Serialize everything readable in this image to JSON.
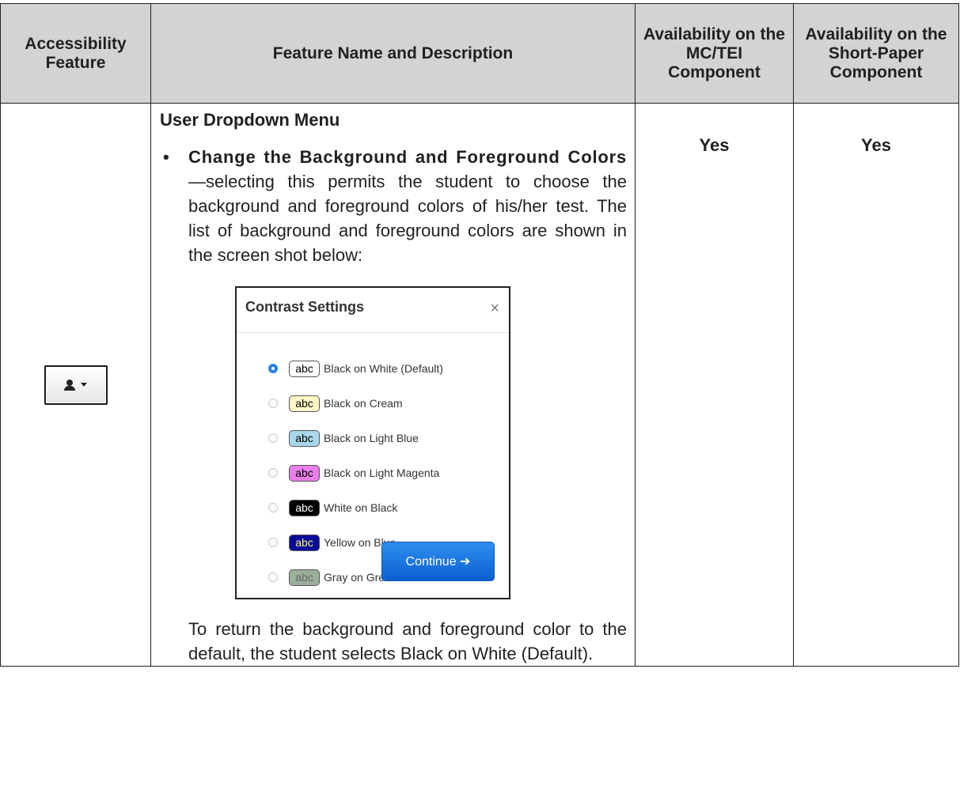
{
  "header": {
    "columns": [
      "Accessibility Feature",
      "Feature Name and Description",
      "Availability on the MC/TEI Component",
      "Availability on the Short-Paper Component"
    ]
  },
  "row": {
    "icon": "user-dropdown-icon",
    "menu_title": "User Dropdown Menu",
    "bullet": "•",
    "bullet_lead": "Change the Background and Foreground Colors",
    "bullet_body": "—selecting this permits the student to choose the background and foreground colors of his/her test. The list of background and foreground colors are shown in the screen shot below:",
    "after_text": "To return the background and foreground color to the default, the student selects Black on White (Default).",
    "mc_tei": "Yes",
    "short_paper": "Yes"
  },
  "dialog": {
    "title": "Contrast Settings",
    "close": "×",
    "continue_label": "Continue ➔",
    "options": [
      {
        "swatch": "abc",
        "label": "Black on White (Default)",
        "selected": true,
        "bg": "#ffffff",
        "fg": "#000000"
      },
      {
        "swatch": "abc",
        "label": "Black on Cream",
        "selected": false,
        "bg": "#fff6c4",
        "fg": "#000000"
      },
      {
        "swatch": "abc",
        "label": "Black on Light Blue",
        "selected": false,
        "bg": "#a9d8ec",
        "fg": "#000000"
      },
      {
        "swatch": "abc",
        "label": "Black on Light Magenta",
        "selected": false,
        "bg": "#e97fe9",
        "fg": "#000000"
      },
      {
        "swatch": "abc",
        "label": "White on Black",
        "selected": false,
        "bg": "#000000",
        "fg": "#ffffff"
      },
      {
        "swatch": "abc",
        "label": "Yellow on Blue",
        "selected": false,
        "bg": "#0a0a9a",
        "fg": "#ffff66"
      },
      {
        "swatch": "abc",
        "label": "Gray on Green",
        "selected": false,
        "bg": "#9caf9a",
        "fg": "#666666"
      }
    ]
  }
}
